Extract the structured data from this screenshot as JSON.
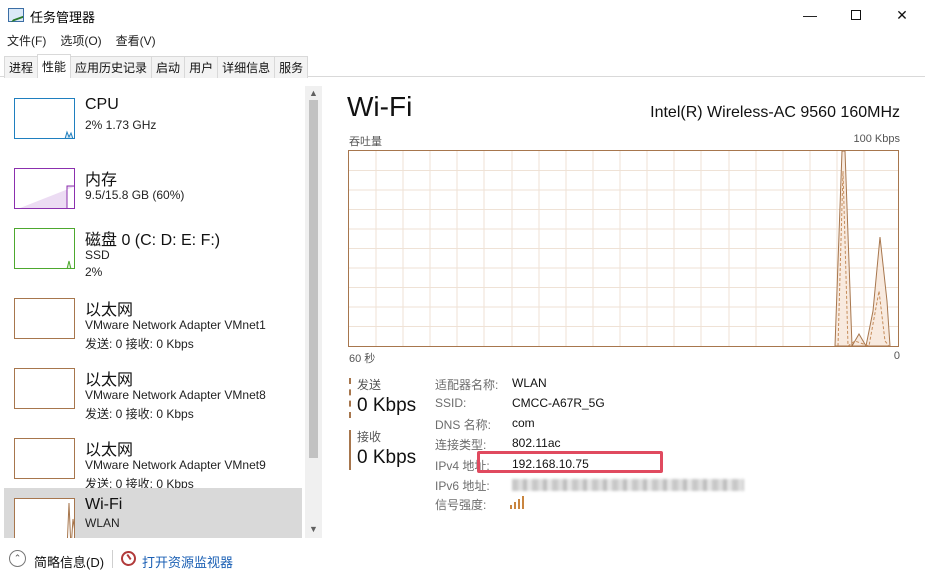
{
  "window": {
    "title": "任务管理器",
    "min_glyph": "—",
    "close_glyph": "✕"
  },
  "menu": [
    "文件(F)",
    "选项(O)",
    "查看(V)"
  ],
  "tabs": [
    "进程",
    "性能",
    "应用历史记录",
    "启动",
    "用户",
    "详细信息",
    "服务"
  ],
  "active_tab": "性能",
  "sidebar": {
    "items": [
      {
        "title": "CPU",
        "line1": "2% 1.73 GHz",
        "line2": "",
        "color": "#1f7fbf"
      },
      {
        "title": "内存",
        "line1": "9.5/15.8 GB (60%)",
        "line2": "",
        "color": "#8b2fae"
      },
      {
        "title": "磁盘 0 (C: D: E: F:)",
        "line1": "SSD",
        "line2": "2%",
        "color": "#4da82e"
      },
      {
        "title": "以太网",
        "line1": "VMware Network Adapter VMnet1",
        "line2": "发送: 0 接收: 0 Kbps",
        "color": "#a7764d"
      },
      {
        "title": "以太网",
        "line1": "VMware Network Adapter VMnet8",
        "line2": "发送: 0 接收: 0 Kbps",
        "color": "#a7764d"
      },
      {
        "title": "以太网",
        "line1": "VMware Network Adapter VMnet9",
        "line2": "发送: 0 接收: 0 Kbps",
        "color": "#a7764d"
      },
      {
        "title": "Wi-Fi",
        "line1": "WLAN",
        "line2": "",
        "color": "#a7764d"
      }
    ]
  },
  "main": {
    "title": "Wi-Fi",
    "adapter": "Intel(R) Wireless-AC 9560 160MHz",
    "chart_label_top_left": "吞吐量",
    "chart_label_top_right": "100 Kbps",
    "chart_label_bottom_left": "60 秒",
    "chart_label_bottom_right": "0",
    "send_label": "发送",
    "send_value": "0 Kbps",
    "recv_label": "接收",
    "recv_value": "0 Kbps",
    "info": [
      {
        "label": "适配器名称:",
        "value": "WLAN"
      },
      {
        "label": "SSID:",
        "value": "CMCC-A67R_5G"
      },
      {
        "label": "DNS 名称:",
        "value": "com"
      },
      {
        "label": "连接类型:",
        "value": "802.11ac"
      },
      {
        "label": "IPv4 地址:",
        "value": "192.168.10.75"
      },
      {
        "label": "IPv6 地址:",
        "value": ""
      },
      {
        "label": "信号强度:",
        "value": ""
      }
    ],
    "accent_color": "#a7764d",
    "highlight_color": "#e04a5f"
  },
  "footer": {
    "less_details": "简略信息(D)",
    "open_monitor": "打开资源监视器"
  }
}
